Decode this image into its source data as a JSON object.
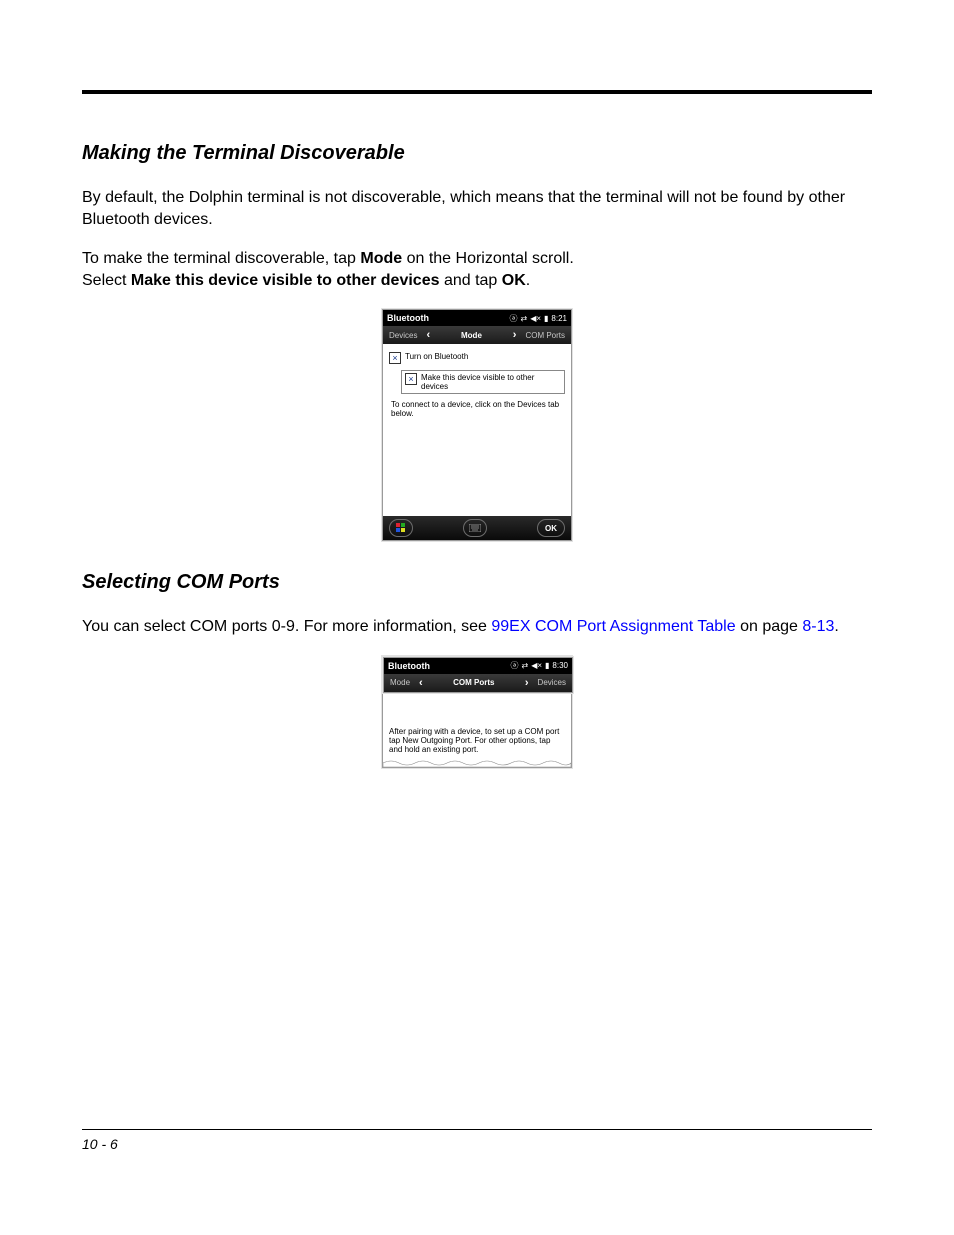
{
  "headings": {
    "h1": "Making the Terminal Discoverable",
    "h2": "Selecting COM Ports"
  },
  "paragraphs": {
    "p1": "By default, the Dolphin terminal is not discoverable, which means that the terminal will not be found by other Bluetooth devices.",
    "p2a": "To make the terminal discoverable, tap ",
    "p2b": "Mode",
    "p2c": " on the Horizontal scroll.",
    "p3a": "Select ",
    "p3b": "Make this device visible to other devices",
    "p3c": " and tap ",
    "p3d": "OK",
    "p3e": ".",
    "p4a": "You can select COM ports 0-9. For more information, see ",
    "p4link": "99EX COM Port Assignment Table",
    "p4b": " on page ",
    "p4pg": "8-13",
    "p4c": "."
  },
  "shot1": {
    "title": "Bluetooth",
    "time": "8:21",
    "tabs": {
      "left": "Devices",
      "center": "Mode",
      "right": "COM Ports"
    },
    "cb1": "Turn on Bluetooth",
    "cb2": "Make this device visible to other devices",
    "hint": "To connect to a device, click on the Devices tab below.",
    "ok": "OK"
  },
  "shot2": {
    "title": "Bluetooth",
    "time": "8:30",
    "tabs": {
      "left": "Mode",
      "center": "COM Ports",
      "right": "Devices"
    },
    "msg": "After pairing with a device, to set up a COM port tap New Outgoing Port. For other options, tap and hold an existing port."
  },
  "footer": {
    "page": "10 - 6"
  }
}
